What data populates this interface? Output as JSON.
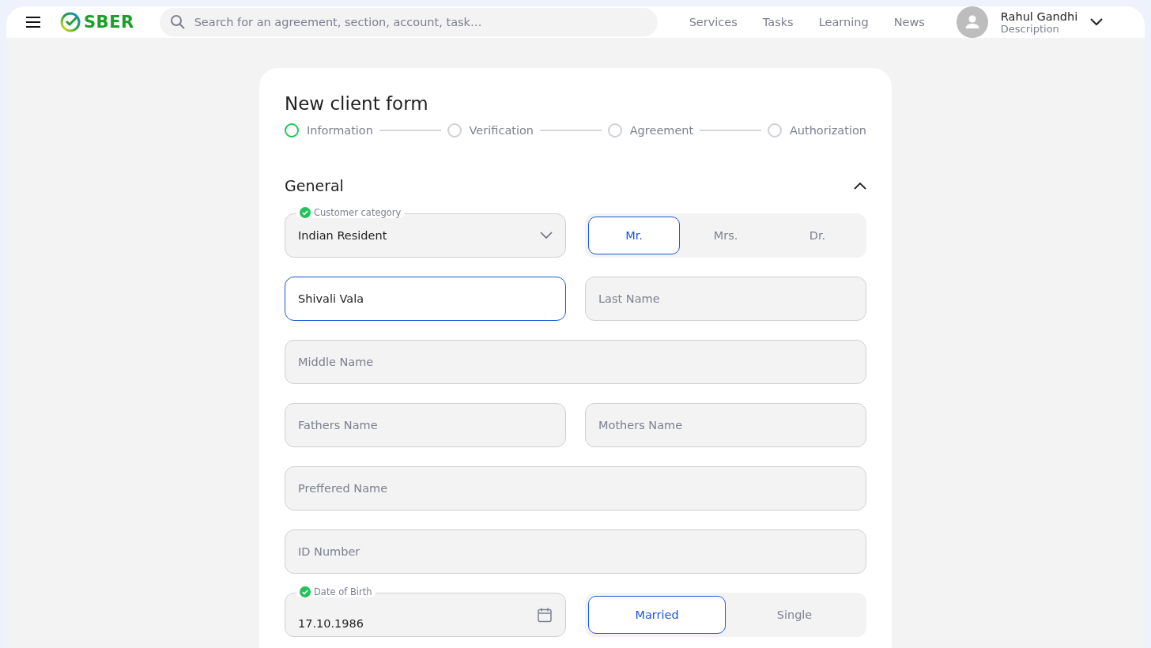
{
  "header": {
    "logo": "SBER",
    "search": {
      "placeholder": "Search for an agreement, section, account, task…"
    },
    "nav": [
      "Services",
      "Tasks",
      "Learning",
      "News"
    ],
    "user": {
      "name": "Rahul Gandhi",
      "description": "Description"
    }
  },
  "form": {
    "title": "New client form",
    "steps": [
      {
        "label": "Information",
        "active": true
      },
      {
        "label": "Verification",
        "active": false
      },
      {
        "label": "Agreement",
        "active": false
      },
      {
        "label": "Authorization",
        "active": false
      }
    ],
    "section": {
      "title": "General",
      "expanded": true
    },
    "rows": [
      {
        "fields": [
          {
            "kind": "select",
            "label": "Customer category",
            "verified": true,
            "value": "Indian Resident"
          },
          {
            "kind": "segmented",
            "options": [
              {
                "label": "Mr.",
                "selected": true
              },
              {
                "label": "Mrs.",
                "selected": false
              },
              {
                "label": "Dr.",
                "selected": false
              }
            ]
          }
        ]
      },
      {
        "fields": [
          {
            "kind": "input",
            "value": "Shivali Vala",
            "focused": true
          },
          {
            "kind": "input",
            "placeholder": "Last Name",
            "focused": false
          }
        ]
      },
      {
        "fields": [
          {
            "kind": "input",
            "placeholder": "Middle Name",
            "focused": false
          }
        ]
      },
      {
        "fields": [
          {
            "kind": "input",
            "placeholder": "Fathers Name",
            "focused": false
          },
          {
            "kind": "input",
            "placeholder": "Mothers Name",
            "focused": false
          }
        ]
      },
      {
        "fields": [
          {
            "kind": "input",
            "placeholder": "Preffered Name",
            "focused": false
          }
        ]
      },
      {
        "fields": [
          {
            "kind": "input",
            "placeholder": "ID Number",
            "focused": false
          }
        ]
      },
      {
        "fields": [
          {
            "kind": "date",
            "label": "Date of Birth",
            "verified": true,
            "value": "17.10.1986"
          },
          {
            "kind": "segmented",
            "options": [
              {
                "label": "Married",
                "selected": true
              },
              {
                "label": "Single",
                "selected": false
              }
            ]
          }
        ]
      }
    ]
  }
}
